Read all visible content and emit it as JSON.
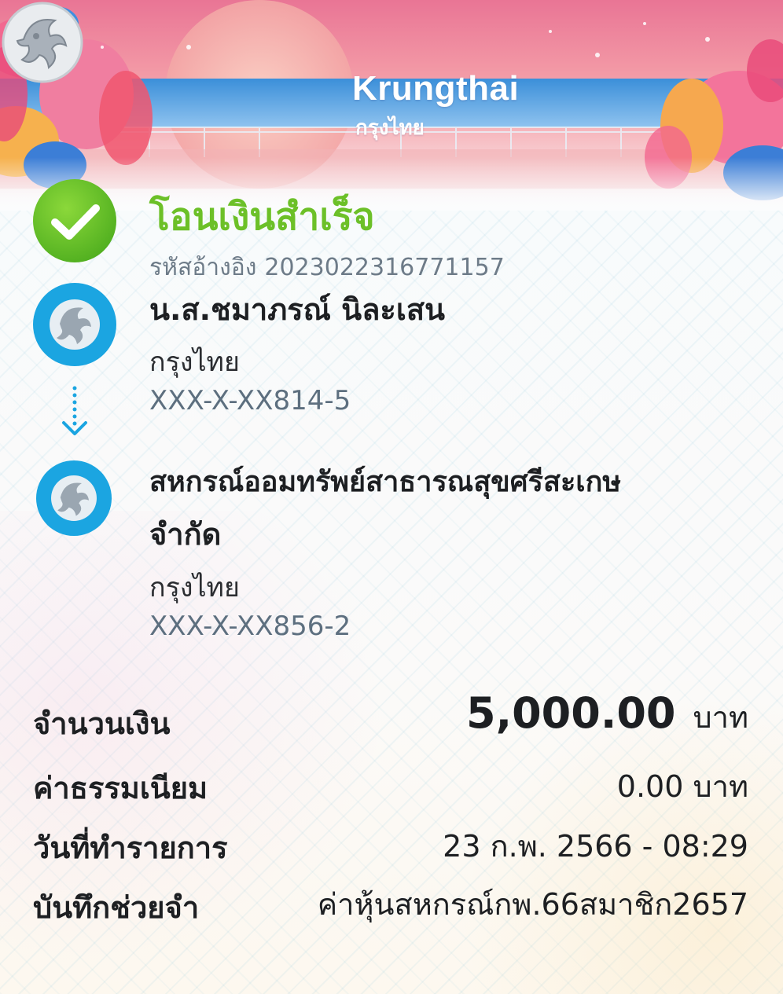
{
  "brand": {
    "name": "Krungthai",
    "name_thai": "กรุงไทย"
  },
  "status": {
    "title": "โอนเงินสำเร็จ",
    "reference_label": "รหัสอ้างอิง",
    "reference_number": "2023022316771157"
  },
  "sender": {
    "name": "น.ส.ชมาภรณ์ นิละเสน",
    "bank": "กรุงไทย",
    "account": "XXX-X-XX814-5"
  },
  "receiver": {
    "name_line1": "สหกรณ์ออมทรัพย์สาธารณสุขศรีสะเกษ",
    "name_line2": "จำกัด",
    "bank": "กรุงไทย",
    "account": "XXX-X-XX856-2"
  },
  "details": {
    "amount_label": "จำนวนเงิน",
    "amount_value": "5,000.00",
    "amount_unit": "บาท",
    "fee_label": "ค่าธรรมเนียม",
    "fee_value": "0.00 บาท",
    "date_label": "วันที่ทำรายการ",
    "date_value": "23 ก.พ. 2566 - 08:29",
    "memo_label": "บันทึกช่วยจำ",
    "memo_value": "ค่าหุ้นสหกรณ์กพ.66สมาชิก2657"
  },
  "colors": {
    "success_green": "#6cc028",
    "brand_blue": "#1ba5e1",
    "account_gray": "#5d6f7f"
  },
  "icons": {
    "check": "check-circle-icon",
    "avatar": "krungthai-bird-icon",
    "arrow": "dotted-arrow-down-icon"
  }
}
